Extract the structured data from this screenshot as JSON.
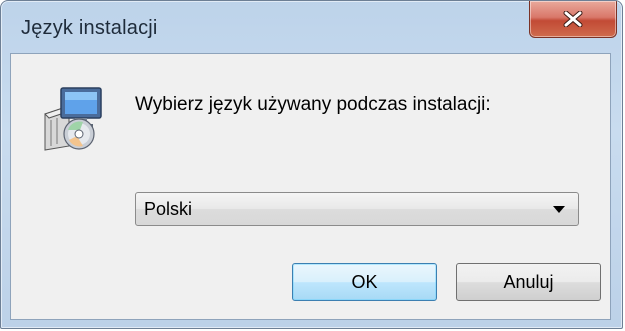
{
  "window": {
    "title": "Język instalacji"
  },
  "titlebar": {
    "close_icon": "close-icon"
  },
  "dialog": {
    "icon": "setup-installer-icon",
    "prompt": "Wybierz język używany podczas instalacji:",
    "language_select": {
      "selected": "Polski"
    },
    "ok_label": "OK",
    "cancel_label": "Anuluj"
  },
  "colors": {
    "close_button": "#c24a35",
    "ok_button_border": "#3c7fb1",
    "frame": "#bdd3ea",
    "client": "#f0f0f0"
  }
}
